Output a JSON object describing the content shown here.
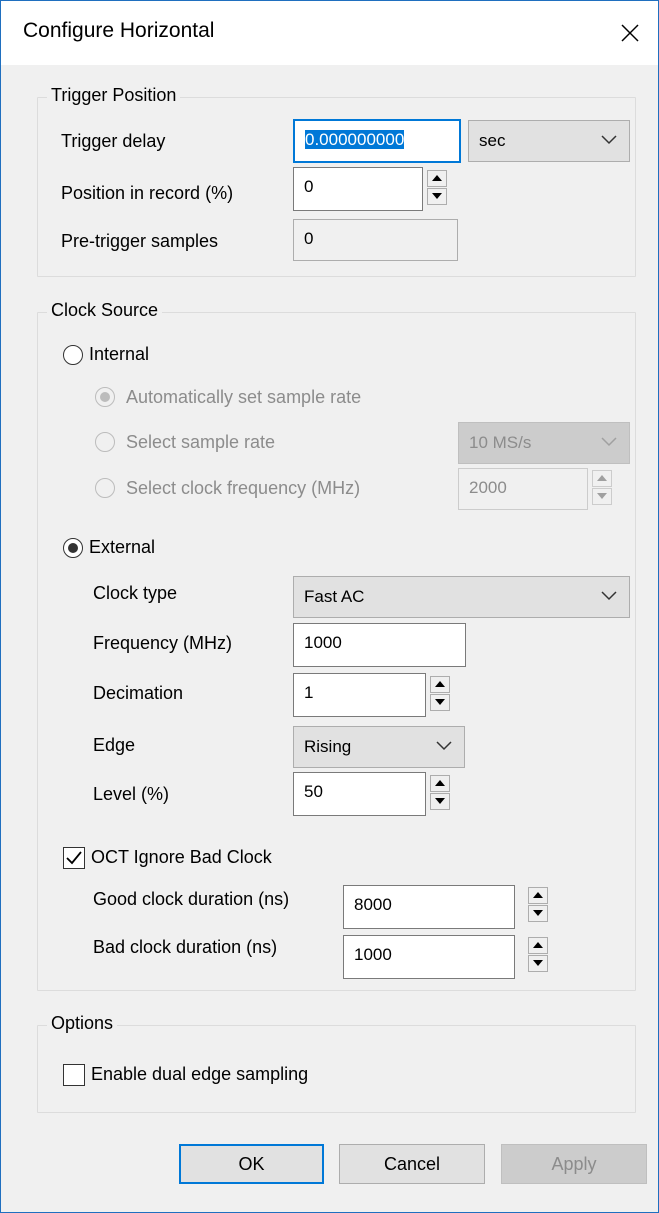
{
  "dialog": {
    "title": "Configure Horizontal"
  },
  "trigger_position": {
    "legend": "Trigger Position",
    "trigger_delay_label": "Trigger delay",
    "trigger_delay_value": "0.000000000",
    "trigger_delay_unit": "sec",
    "position_label": "Position in record (%)",
    "position_value": "0",
    "pretrigger_label": "Pre-trigger samples",
    "pretrigger_value": "0"
  },
  "clock_source": {
    "legend": "Clock Source",
    "internal_label": "Internal",
    "internal_selected": false,
    "auto_rate_label": "Automatically set sample rate",
    "select_rate_label": "Select sample rate",
    "sample_rate_value": "10 MS/s",
    "select_clock_freq_label": "Select clock frequency (MHz)",
    "clock_freq_value": "2000",
    "external_label": "External",
    "external_selected": true,
    "clock_type_label": "Clock type",
    "clock_type_value": "Fast AC",
    "frequency_label": "Frequency (MHz)",
    "frequency_value": "1000",
    "decimation_label": "Decimation",
    "decimation_value": "1",
    "edge_label": "Edge",
    "edge_value": "Rising",
    "level_label": "Level (%)",
    "level_value": "50",
    "oct_ignore_label": "OCT Ignore Bad Clock",
    "oct_ignore_checked": true,
    "good_duration_label": "Good clock duration (ns)",
    "good_duration_value": "8000",
    "bad_duration_label": "Bad clock duration (ns)",
    "bad_duration_value": "1000"
  },
  "options": {
    "legend": "Options",
    "dual_edge_label": "Enable dual edge sampling",
    "dual_edge_checked": false
  },
  "buttons": {
    "ok": "OK",
    "cancel": "Cancel",
    "apply": "Apply"
  },
  "colors": {
    "accent": "#0078d7",
    "window_border": "#1f6fbf",
    "disabled_text": "#8c8c8c"
  },
  "icons": {
    "close": "close-icon",
    "dropdown": "chevron-down-icon",
    "spin_up": "spin-up-icon",
    "spin_down": "spin-down-icon",
    "check": "checkmark-icon"
  }
}
